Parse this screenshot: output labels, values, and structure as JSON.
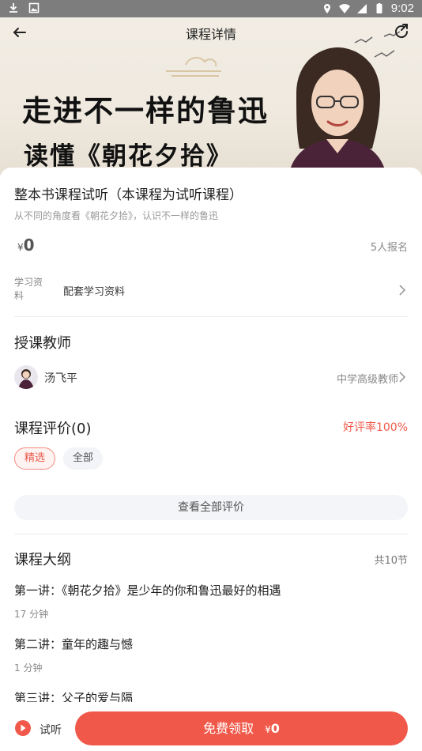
{
  "status_bar": {
    "time": "9:02"
  },
  "nav": {
    "title": "课程详情"
  },
  "banner": {
    "headline1": "走进不一样的鲁迅",
    "headline2": "读懂《朝花夕拾》"
  },
  "course": {
    "title": "整本书课程试听（本课程为试听课程）",
    "subtitle": "从不同的角度看《朝花夕拾》，认识不一样的鲁迅",
    "currency": "¥",
    "price": "0",
    "enrolled": "5人报名",
    "material_label": "学习资料",
    "material_value": "配套学习资料"
  },
  "teacher_section": {
    "title": "授课教师",
    "name": "汤飞平",
    "role": "中学高级教师"
  },
  "review_section": {
    "title": "课程评价(0)",
    "rating": "好评率100%",
    "tags": [
      "精选",
      "全部"
    ],
    "view_all": "查看全部评价"
  },
  "outline": {
    "title": "课程大纲",
    "count": "共10节",
    "lessons": [
      {
        "title": "第一讲：《朝花夕拾》是少年的你和鲁迅最好的相遇",
        "duration": "17 分钟"
      },
      {
        "title": "第二讲：童年的趣与憾",
        "duration": "1 分钟"
      },
      {
        "title": "第三讲：父子的爱与隔",
        "duration": ""
      }
    ]
  },
  "bottom": {
    "trial_label": "试听",
    "claim_label": "免费领取",
    "claim_currency": "¥",
    "claim_price": "0"
  },
  "colors": {
    "accent": "#f0594a",
    "status_bar": "#7d7d7d"
  }
}
